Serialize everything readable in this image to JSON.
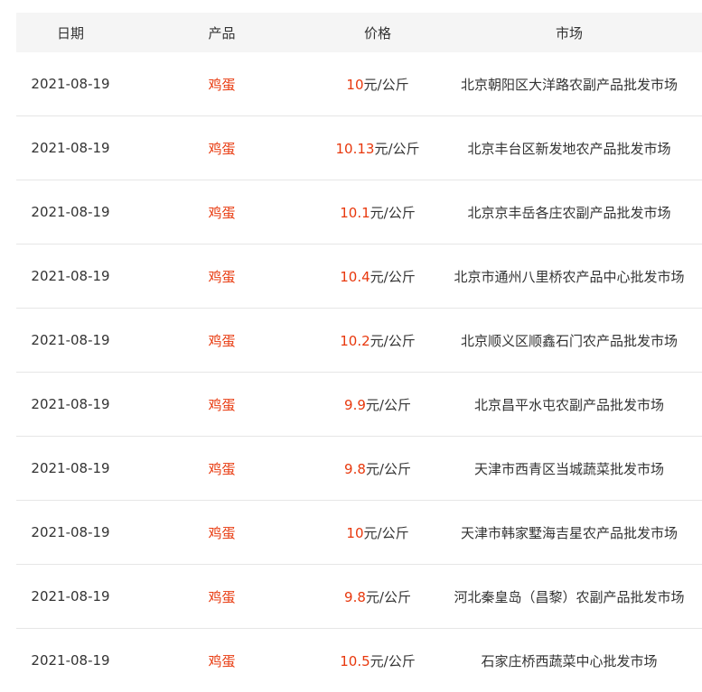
{
  "headers": {
    "date": "日期",
    "product": "产品",
    "price": "价格",
    "market": "市场"
  },
  "colors": {
    "accent": "#e8380d",
    "header_bg": "#f5f5f5",
    "divider": "#e6e6e6"
  },
  "rows": [
    {
      "date": "2021-08-19",
      "product": "鸡蛋",
      "price_value": "10",
      "price_unit": "元/公斤",
      "market": "北京朝阳区大洋路农副产品批发市场"
    },
    {
      "date": "2021-08-19",
      "product": "鸡蛋",
      "price_value": "10.13",
      "price_unit": "元/公斤",
      "market": "北京丰台区新发地农产品批发市场"
    },
    {
      "date": "2021-08-19",
      "product": "鸡蛋",
      "price_value": "10.1",
      "price_unit": "元/公斤",
      "market": "北京京丰岳各庄农副产品批发市场"
    },
    {
      "date": "2021-08-19",
      "product": "鸡蛋",
      "price_value": "10.4",
      "price_unit": "元/公斤",
      "market": "北京市通州八里桥农产品中心批发市场"
    },
    {
      "date": "2021-08-19",
      "product": "鸡蛋",
      "price_value": "10.2",
      "price_unit": "元/公斤",
      "market": "北京顺义区顺鑫石门农产品批发市场"
    },
    {
      "date": "2021-08-19",
      "product": "鸡蛋",
      "price_value": "9.9",
      "price_unit": "元/公斤",
      "market": "北京昌平水屯农副产品批发市场"
    },
    {
      "date": "2021-08-19",
      "product": "鸡蛋",
      "price_value": "9.8",
      "price_unit": "元/公斤",
      "market": "天津市西青区当城蔬菜批发市场"
    },
    {
      "date": "2021-08-19",
      "product": "鸡蛋",
      "price_value": "10",
      "price_unit": "元/公斤",
      "market": "天津市韩家墅海吉星农产品批发市场"
    },
    {
      "date": "2021-08-19",
      "product": "鸡蛋",
      "price_value": "9.8",
      "price_unit": "元/公斤",
      "market": "河北秦皇岛（昌黎）农副产品批发市场"
    },
    {
      "date": "2021-08-19",
      "product": "鸡蛋",
      "price_value": "10.5",
      "price_unit": "元/公斤",
      "market": "石家庄桥西蔬菜中心批发市场"
    }
  ]
}
